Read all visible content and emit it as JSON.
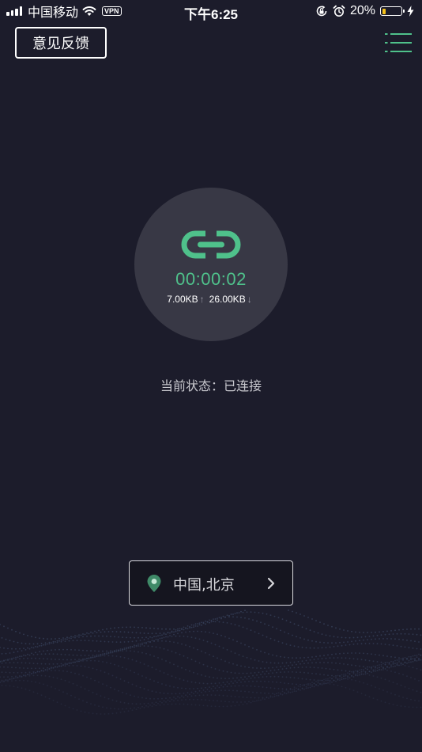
{
  "status_bar": {
    "carrier": "中国移动",
    "vpn": "VPN",
    "time": "下午6:25",
    "battery_percent": "20%",
    "battery_level": 0.2,
    "icons": [
      "signal-icon",
      "wifi-icon",
      "vpn-icon",
      "orientation-lock-icon",
      "alarm-icon",
      "battery-icon",
      "charging-icon"
    ]
  },
  "header": {
    "feedback_label": "意见反馈",
    "menu_icon": "list-menu-icon"
  },
  "connection": {
    "icon": "link-icon",
    "timer": "00:00:02",
    "upload": "7.00KB",
    "upload_arrow": "↑",
    "download": "26.00KB",
    "download_arrow": "↓",
    "status": "当前状态：已连接"
  },
  "location": {
    "icon": "map-pin-icon",
    "label": "中国,北京",
    "chevron": "chevron-right-icon"
  },
  "colors": {
    "background": "#1c1c2b",
    "accent": "#4fc18b",
    "circle": "#383845",
    "battery": "#f5c21b"
  }
}
